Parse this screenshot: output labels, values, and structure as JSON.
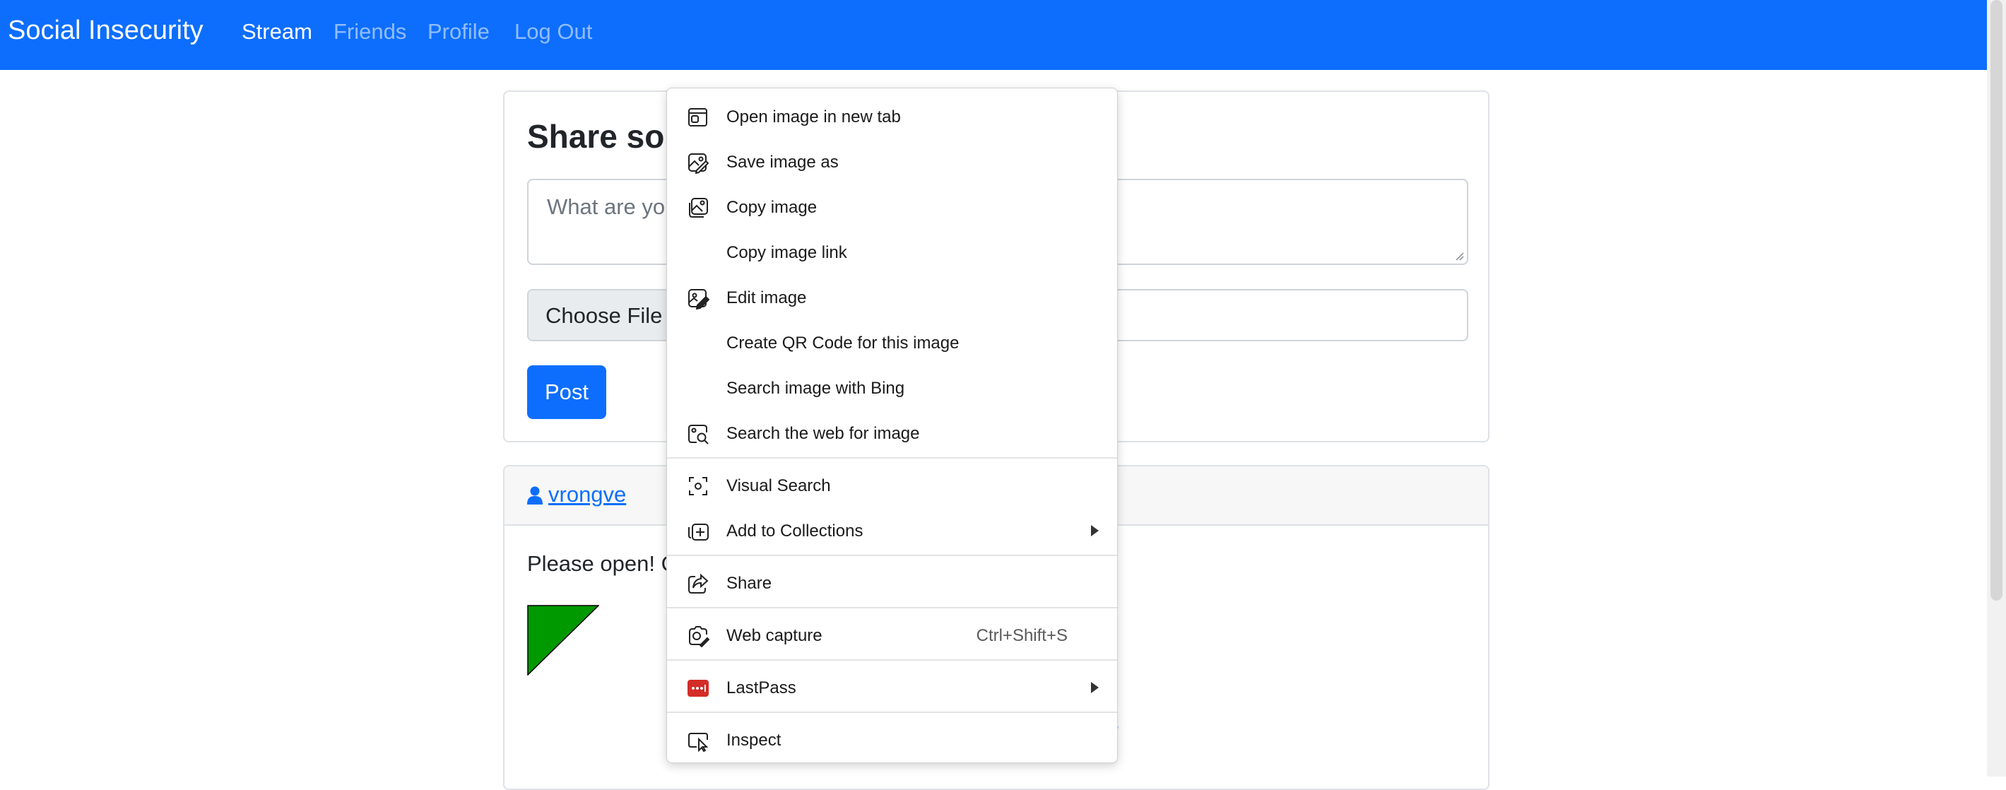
{
  "navbar": {
    "brand": "Social Insecurity",
    "links": [
      "Stream",
      "Friends",
      "Profile",
      "Log Out"
    ],
    "active": "Stream",
    "color": "#0d6efd"
  },
  "share_card": {
    "title": "Share sor",
    "textarea_placeholder": "What are yo",
    "choose_file_label": "Choose File",
    "post_button": "Post"
  },
  "post": {
    "author": "vrongve",
    "text": "Please open! C",
    "link_fragment": ")"
  },
  "context_menu": {
    "items": [
      {
        "label": "Open image in new tab",
        "icon": "open-in-new-tab-icon"
      },
      {
        "label": "Save image as",
        "icon": "save-image-icon"
      },
      {
        "label": "Copy image",
        "icon": "copy-image-icon"
      },
      {
        "label": "Copy image link",
        "icon": ""
      },
      {
        "label": "Edit image",
        "icon": "edit-image-icon"
      },
      {
        "label": "Create QR Code for this image",
        "icon": ""
      },
      {
        "label": "Search image with Bing",
        "icon": ""
      },
      {
        "label": "Search the web for image",
        "icon": "search-image-icon"
      },
      {
        "label": "Visual Search",
        "icon": "visual-search-icon"
      },
      {
        "label": "Add to Collections",
        "icon": "collections-icon",
        "submenu": true
      },
      {
        "label": "Share",
        "icon": "share-icon"
      },
      {
        "label": "Web capture",
        "icon": "web-capture-icon",
        "shortcut": "Ctrl+Shift+S"
      },
      {
        "label": "LastPass",
        "icon": "lastpass-icon",
        "submenu": true
      },
      {
        "label": "Inspect",
        "icon": "inspect-icon"
      }
    ]
  }
}
